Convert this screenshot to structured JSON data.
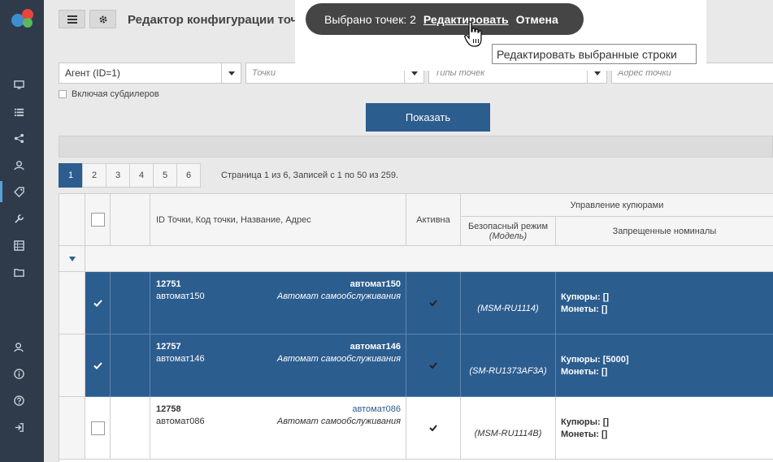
{
  "header": {
    "menu_icon": "hamburger-icon",
    "settings_icon": "gear-icon",
    "title": "Редактор конфигурации точек"
  },
  "sidebar": {
    "items": [
      {
        "icon": "monitor-icon"
      },
      {
        "icon": "list-icon"
      },
      {
        "icon": "share-icon"
      },
      {
        "icon": "user-icon"
      },
      {
        "icon": "tag-icon",
        "active": true
      },
      {
        "icon": "wrench-icon"
      },
      {
        "icon": "table-icon"
      },
      {
        "icon": "folder-icon"
      },
      {
        "icon": "users-icon"
      },
      {
        "icon": "info-icon"
      },
      {
        "icon": "help-icon"
      },
      {
        "icon": "logout-icon"
      }
    ]
  },
  "filters": {
    "agent": "Агент (ID=1)",
    "points_placeholder": "Точки",
    "point_types_placeholder": "Типы точек",
    "address_placeholder": "Адрес точки",
    "include_subdealers": "Включая субдилеров"
  },
  "show_button": "Показать",
  "pagination": {
    "pages": [
      "1",
      "2",
      "3",
      "4",
      "5",
      "6"
    ],
    "current": "1",
    "info": "Страница 1 из 6, Записей с 1 по 50 из 259."
  },
  "table": {
    "headers": {
      "id": "ID Точки,  Код точки,  Название,  Адрес",
      "active": "Активна",
      "banknote_group": "Управление купюрами",
      "safe_mode": "Безопасный режим",
      "safe_mode_sub": "(Модель)",
      "forbidden": "Запрещенные номиналы"
    },
    "rows": [
      {
        "selected": true,
        "id": "12751",
        "code": "автомат150",
        "name": "автомат150",
        "type": "Автомат самообслуживания",
        "model": "(MSM-RU1114)",
        "kup": "Купюры: []",
        "mon": "Монеты: []"
      },
      {
        "selected": true,
        "id": "12757",
        "code": "автомат146",
        "name": "автомат146",
        "type": "Автомат самообслуживания",
        "model": "(SM-RU1373AF3A)",
        "kup": "Купюры: [5000]",
        "mon": "Монеты: []"
      },
      {
        "selected": false,
        "id": "12758",
        "code": "автомат086",
        "name": "автомат086",
        "type": "Автомат самообслуживания",
        "model": "(MSM-RU1114B)",
        "kup": "Купюры: []",
        "mon": "Монеты: []"
      }
    ]
  },
  "toast": {
    "selected_text": "Выбрано точек: 2",
    "edit_link": "Редактировать",
    "cancel_link": "Отмена",
    "tooltip": "Редактировать выбранные строки"
  },
  "colors": {
    "sidebar_bg": "#2f3b4a",
    "accent": "#2c5d8f",
    "toast_bg": "#454545"
  }
}
